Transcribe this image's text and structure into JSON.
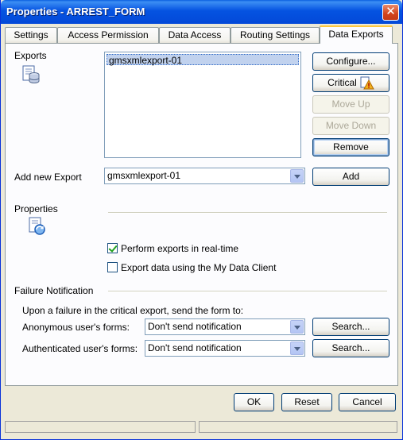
{
  "window": {
    "title": "Properties - ARREST_FORM",
    "close_label": "✕"
  },
  "tabs": [
    {
      "label": "Settings"
    },
    {
      "label": "Access Permission"
    },
    {
      "label": "Data Access"
    },
    {
      "label": "Routing Settings"
    },
    {
      "label": "Data Exports",
      "active": true
    }
  ],
  "exports": {
    "label": "Exports",
    "items": [
      "gmsxmlexport-01"
    ],
    "buttons": {
      "configure": "Configure...",
      "critical": "Critical",
      "move_up": "Move Up",
      "move_down": "Move Down",
      "remove": "Remove"
    }
  },
  "add_export": {
    "label": "Add new Export",
    "selected": "gmsxmlexport-01",
    "add_label": "Add"
  },
  "properties": {
    "label": "Properties",
    "realtime": {
      "label": "Perform exports in real-time",
      "checked": true
    },
    "mydataclient": {
      "label": "Export data using the My Data Client",
      "checked": false
    }
  },
  "failure": {
    "label": "Failure Notification",
    "description": "Upon a failure in the critical export, send the form to:",
    "anonymous": {
      "label": "Anonymous user's forms:",
      "selected": "Don't send notification",
      "search_label": "Search..."
    },
    "authenticated": {
      "label": "Authenticated user's forms:",
      "selected": "Don't send notification",
      "search_label": "Search..."
    }
  },
  "footer": {
    "ok": "OK",
    "reset": "Reset",
    "cancel": "Cancel"
  },
  "colors": {
    "titlebar": "#0553e1",
    "selection": "#c1d2ee",
    "tab_highlight": "#ffc83c"
  }
}
